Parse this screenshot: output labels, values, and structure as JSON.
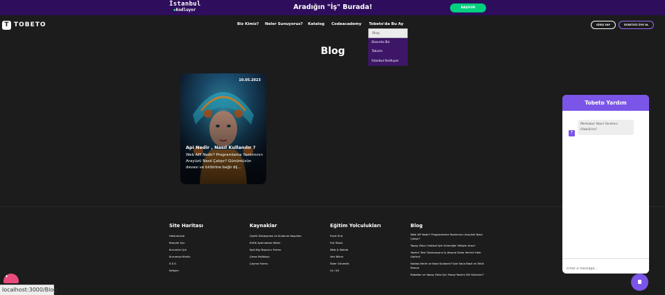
{
  "announcement": {
    "logo_line1": "İstanbul",
    "logo_line2": "Kodluyor",
    "title": "Aradığın \"İş\" Burada!",
    "apply_button": "BAŞVUR"
  },
  "navbar": {
    "brand": "TOBETO",
    "links": [
      "Biz Kimiz?",
      "Neler Sunuyoruz?",
      "Katalog",
      "Codeacademy",
      "Tobeto'da Bu Ay"
    ],
    "login_button": "GİRİŞ YAP",
    "signup_button": "ÜCRETSİZ ÜYE OL"
  },
  "dropdown": {
    "items": [
      "Blog",
      "Basında Biz",
      "Takvim",
      "İstanbul Kodluyor"
    ]
  },
  "page": {
    "title": "Blog"
  },
  "card": {
    "date": "10.05.2023",
    "title": "Api Nedir , Nasıl Kullanılır ?",
    "description": "Web API Nedir? Programlama Yazılımının Arayüzü Nasıl Çalışır? Günümüzün devası ve birbirine bağlı dij..."
  },
  "footer": {
    "site_map": {
      "heading": "Site Haritası",
      "links": [
        "Hakkımızda",
        "Bireyler İçin",
        "Kurumlar İçin",
        "Kurumsal Kimlik",
        "S.S.S.",
        "İletişim"
      ]
    },
    "resources": {
      "heading": "Kaynaklar",
      "links": [
        "Üyelik Sözleşmesi ve Kullanım Koşulları",
        "KVKK Aydınlatma Metni",
        "İlgili Kişi Başvuru Formu",
        "Çerez Politikası",
        "Çayma Formu"
      ]
    },
    "education": {
      "heading": "Eğitim Yolculukları",
      "links": [
        "Front End",
        "Full Stack",
        "Web & Mobile",
        "Veri Bilimi",
        "Siber Güvenlik",
        "UI / UX"
      ]
    },
    "blog": {
      "heading": "Blog",
      "links": [
        "Web API Nedir? Programlama Yazılımının Arayüzü Nasıl Çalışır?",
        "Yapay Zeka Chatbot İşte Geleceğin İletişim Aracı!",
        "Yazılım Test Otomasyonu İş Akışına Daha Verimli Hale Getirin!",
        "Nodejs Nedir ve Nasıl Kullanılır? İşte Sana Basit ve Etkili Klavuz",
        "Robotlar ve Yapay Zeka İçin Hangi Yazılım Dili Kullanılır?"
      ]
    }
  },
  "chat": {
    "header": "Tobeto Yardım",
    "avatar_letter": "T",
    "bot_message": "Merhaba! Nasıl Yardımcı Olabilirim?",
    "input_placeholder": "Enter a message..."
  },
  "status_bar": {
    "url": "localhost:3000/Blog"
  },
  "colors": {
    "background": "#1c1c1c",
    "announcement_bg": "#2e0d5c",
    "apply_button": "#00cf7f",
    "dropdown_bg": "#3d1667",
    "chat_accent": "#7b55e8"
  },
  "icons": {
    "chat_fab": "chat-widget-icon",
    "corner": "badge-icon"
  }
}
